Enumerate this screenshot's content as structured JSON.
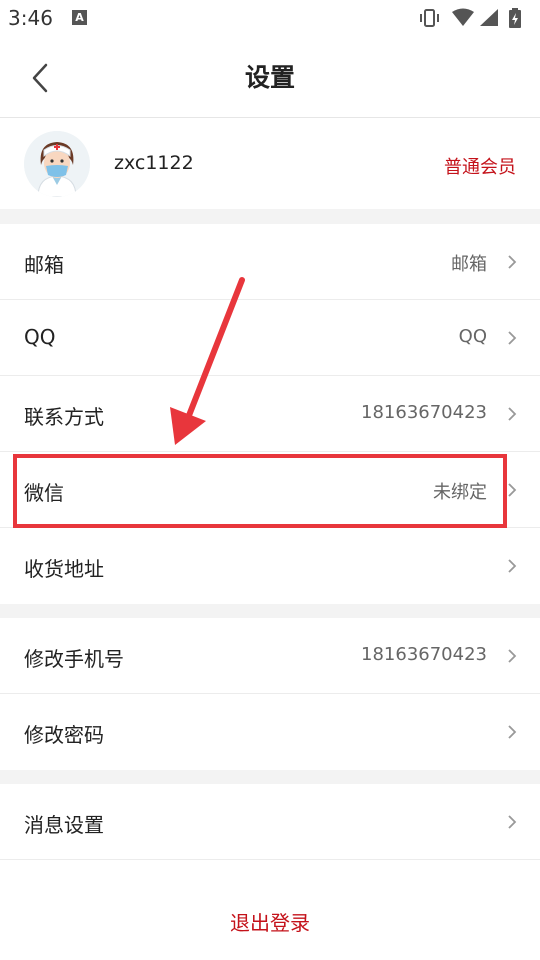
{
  "status_bar": {
    "time": "3:46",
    "notification_letter": "A",
    "icons": [
      "vibrate-icon",
      "wifi-icon",
      "signal-icon",
      "battery-icon"
    ]
  },
  "nav": {
    "title": "设置",
    "back_icon": "chevron-left-icon"
  },
  "profile": {
    "username": "zxc1122",
    "member_level": "普通会员"
  },
  "rows": [
    {
      "label": "邮箱",
      "value": "邮箱"
    },
    {
      "label": "QQ",
      "value": "QQ"
    },
    {
      "label": "联系方式",
      "value": "18163670423"
    },
    {
      "label": "微信",
      "value": "未绑定"
    },
    {
      "label": "收货地址",
      "value": ""
    },
    {
      "label": "修改手机号",
      "value": "18163670423"
    },
    {
      "label": "修改密码",
      "value": ""
    },
    {
      "label": "消息设置",
      "value": ""
    }
  ],
  "logout_label": "退出登录",
  "colors": {
    "accent": "#c4121a",
    "annotation": "#e8363c",
    "section_gap": "#f3f3f3"
  }
}
